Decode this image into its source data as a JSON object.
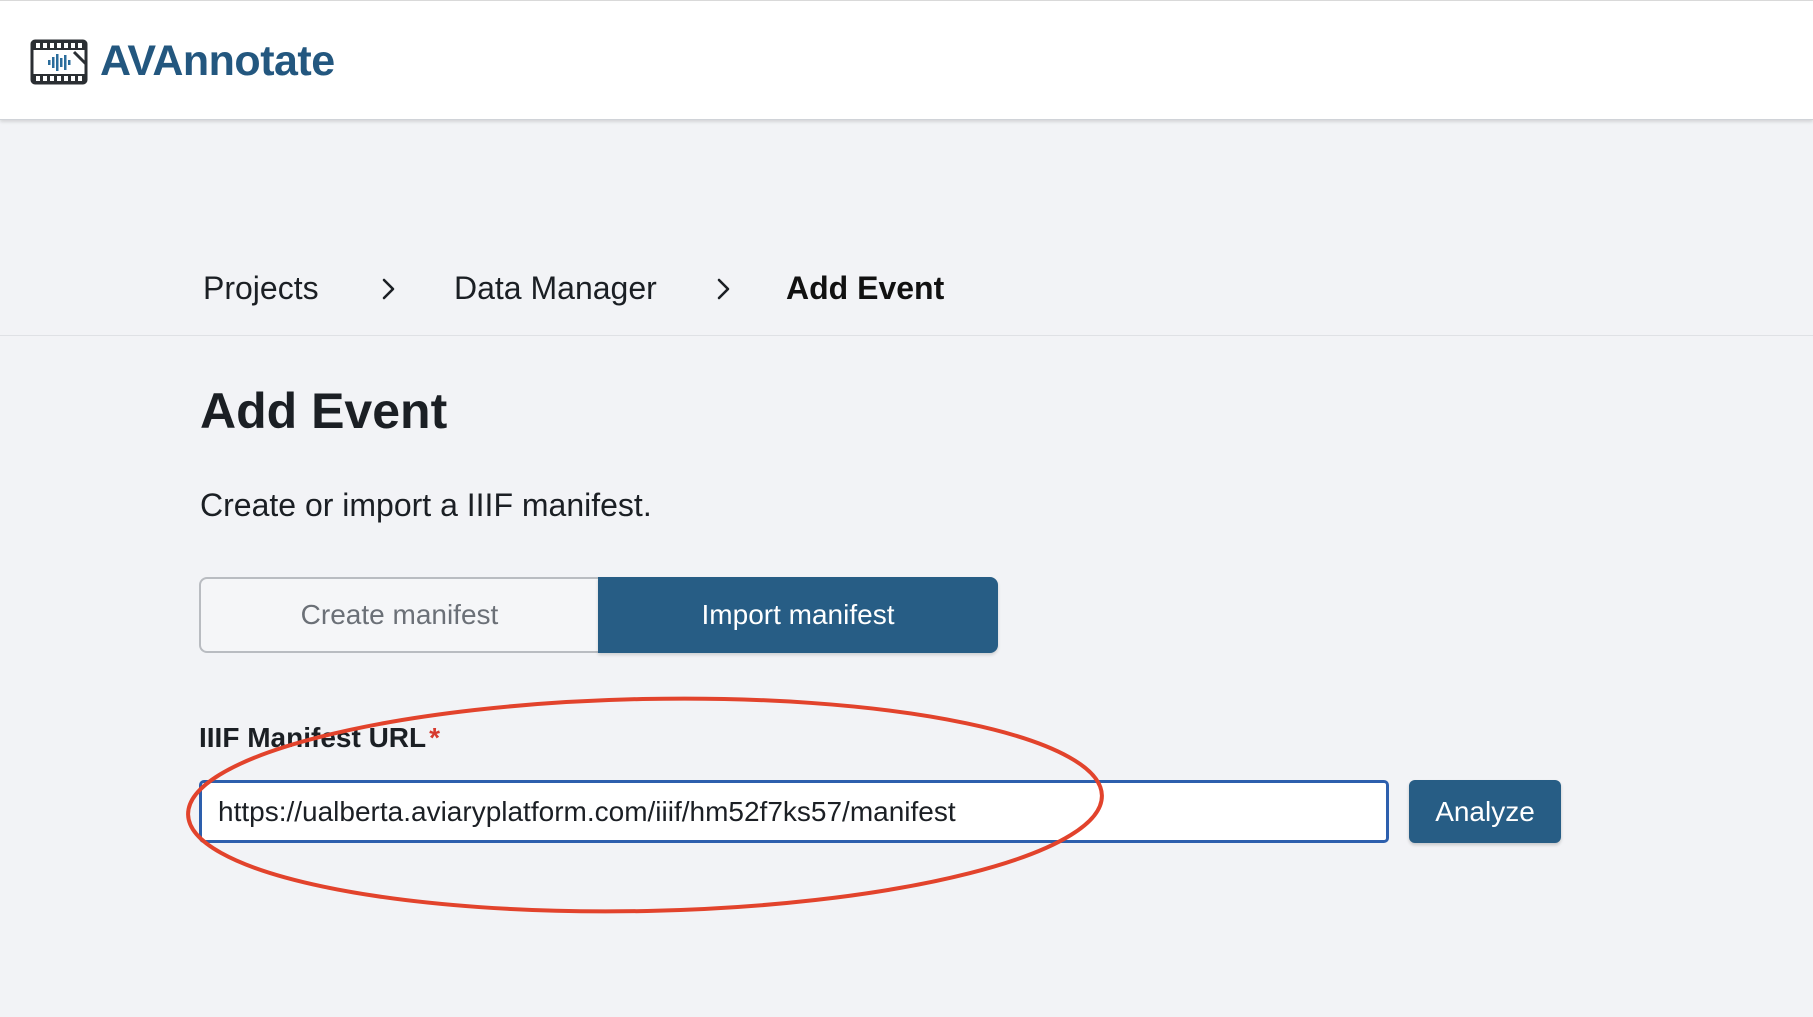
{
  "app": {
    "name": "AVAnnotate",
    "logo_icon": "film-audio-icon",
    "brand_color": "#23577f"
  },
  "breadcrumb": {
    "items": [
      {
        "label": "Projects"
      },
      {
        "label": "Data Manager"
      },
      {
        "label": "Add Event"
      }
    ],
    "separator_icon": "chevron-right-icon"
  },
  "page": {
    "title": "Add Event",
    "subtitle": "Create or import a IIIF manifest."
  },
  "manifest_mode": {
    "create_label": "Create manifest",
    "import_label": "Import manifest",
    "selected": "Import manifest"
  },
  "manifest_url": {
    "label": "IIIF Manifest URL",
    "required_marker": "*",
    "value": "https://ualberta.aviaryplatform.com/iiif/hm52f7ks57/manifest"
  },
  "analyze": {
    "label": "Analyze"
  },
  "colors": {
    "primary": "#275d85",
    "focus_border": "#2d5fad",
    "annotation": "#e2432c",
    "required": "#d63a2e",
    "background": "#f2f3f6"
  }
}
